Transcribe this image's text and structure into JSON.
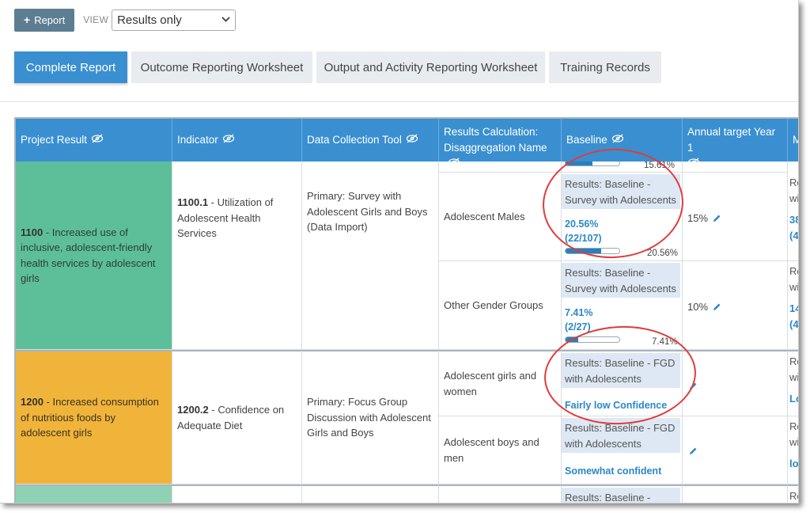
{
  "toolbar": {
    "report_button": "Report",
    "view_label": "VIEW",
    "view_select": "Results only"
  },
  "tabs": [
    {
      "label": "Complete Report",
      "active": true
    },
    {
      "label": "Outcome Reporting Worksheet",
      "active": false
    },
    {
      "label": "Output and Activity Reporting Worksheet",
      "active": false
    },
    {
      "label": "Training Records",
      "active": false
    }
  ],
  "columns": {
    "project_result": "Project Result",
    "indicator": "Indicator",
    "data_collection_tool": "Data Collection Tool",
    "results_calc_1": "Results Calculation:",
    "results_calc_2": "Disaggregation Name",
    "baseline": "Baseline",
    "annual_target": "Annual target Year 1",
    "next_col_partial": "M"
  },
  "rows": {
    "r1100": {
      "code": "1100",
      "result": " - Increased use of inclusive, adolescent-friendly health services by adolescent girls",
      "indicator_code": "1100.1",
      "indicator": " - Utilization of Adolescent Health Services",
      "tool": "Primary: Survey with Adolescent Girls and Boys (Data Import)",
      "top_partial_bar_label": "15.61%",
      "sub": [
        {
          "name": "Adolescent Males",
          "baseline_label": "Results: Baseline - Survey with Adolescents",
          "value": "20.56%",
          "fraction": "(22/107)",
          "bar_label": "20.56%",
          "bar_fraction": 0.2056,
          "target": "15%",
          "next_partial_1": "Re",
          "next_partial_2": "wi",
          "next_partial_3": "38",
          "next_partial_4": "(4"
        },
        {
          "name": "Other Gender Groups",
          "baseline_label": "Results: Baseline - Survey with Adolescents",
          "value": "7.41%",
          "fraction": "(2/27)",
          "bar_label": "7.41%",
          "bar_fraction": 0.0741,
          "target": "10%",
          "next_partial_1": "Re",
          "next_partial_2": "wi",
          "next_partial_3": "14",
          "next_partial_4": "(4"
        }
      ]
    },
    "r1200": {
      "code": "1200",
      "result": " - Increased consumption of nutritious foods by adolescent girls",
      "indicator_code": "1200.2",
      "indicator": " - Confidence on Adequate Diet",
      "tool": "Primary: Focus Group Discussion with Adolescent Girls and Boys",
      "sub": [
        {
          "name": "Adolescent girls and women",
          "baseline_label": "Results: Baseline - FGD with Adolescents",
          "value": "Fairly low Confidence",
          "next_partial_1": "Re",
          "next_partial_2": "wi",
          "next_partial_3": "Lo"
        },
        {
          "name": "Adolescent boys and men",
          "baseline_label": "Results: Baseline - FGD with Adolescents",
          "value": "Somewhat confident",
          "next_partial_1": "Re",
          "next_partial_2": "wi",
          "next_partial_3": "lo"
        }
      ]
    },
    "r_next": {
      "baseline_label": "Results: Baseline - Survey",
      "next_partial_1": "Re"
    }
  },
  "colors": {
    "header_blue": "#3a8fd0",
    "green_row": "#5dbf9a",
    "orange_row": "#f0b43a",
    "highlight_ring": "#e03c3c",
    "value_blue": "#2a87c8"
  },
  "icons": {
    "column_visibility": "eye-slash-icon",
    "edit": "pencil-icon",
    "add": "plus-icon",
    "dropdown": "chevron-down-icon"
  }
}
